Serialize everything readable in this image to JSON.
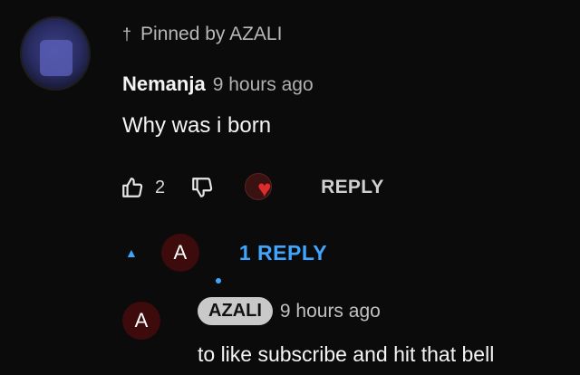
{
  "comment": {
    "pinned_label": "Pinned by AZALI",
    "author": "Nemanja",
    "time": "9 hours ago",
    "text": "Why was i born",
    "like_count": "2",
    "reply_label": "REPLY",
    "replies_label": "1 REPLY",
    "creator_avatar_letter": "A"
  },
  "reply": {
    "avatar_letter": "A",
    "author": "AZALI",
    "time": "9 hours ago",
    "text": "to like subscribe and hit that bell"
  },
  "icons": {
    "pin": "pin-icon",
    "like": "thumbs-up-icon",
    "dislike": "thumbs-down-icon",
    "heart": "creator-heart-icon",
    "caret": "caret-up-icon"
  },
  "colors": {
    "background": "#0b0b0b",
    "link_blue": "#3ea6ff",
    "heart_red": "#e02b2b",
    "pill_bg": "#c9c9c9"
  }
}
